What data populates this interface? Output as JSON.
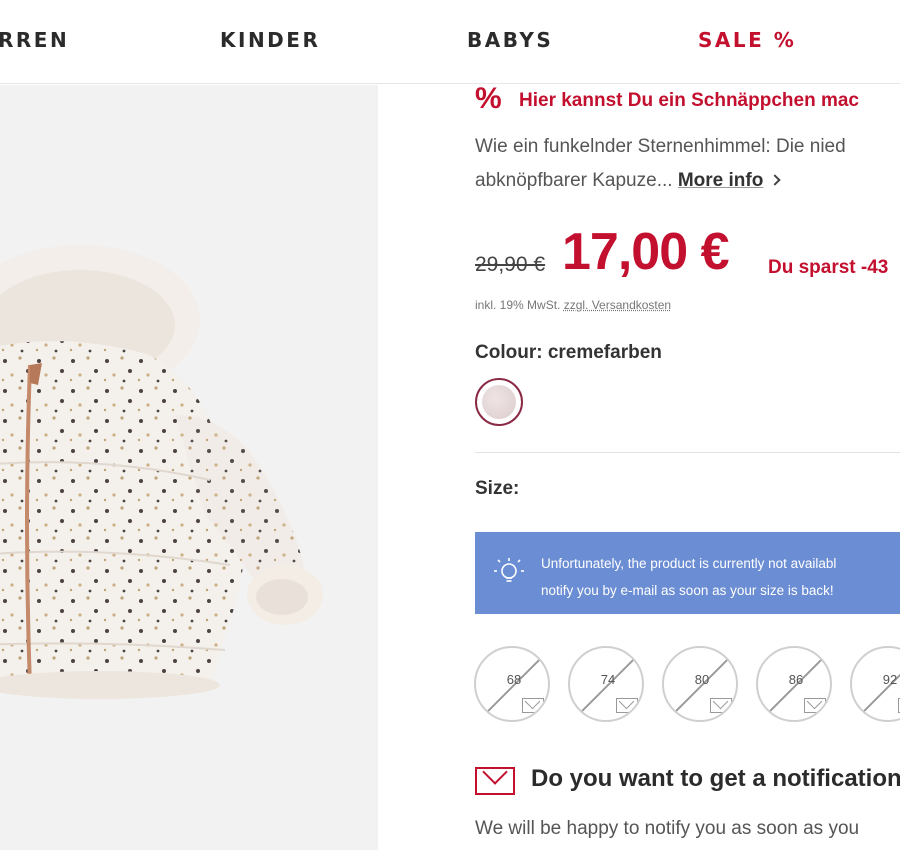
{
  "nav": {
    "items": [
      {
        "label": "RREN"
      },
      {
        "label": "KINDER"
      },
      {
        "label": "BABYS"
      },
      {
        "label": "SALE %"
      }
    ]
  },
  "deal": {
    "icon_text": "%",
    "text": "Hier kannst Du ein Schnäppchen mac"
  },
  "description": {
    "line1": "Wie ein funkelnder Sternenhimmel: Die nied",
    "line2": "abknöpfbarer Kapuze...",
    "more_info": "More info"
  },
  "price": {
    "old": "29,90 €",
    "new": "17,00 €",
    "savings": "Du sparst -43"
  },
  "vat": {
    "prefix": "inkl. 19% MwSt.",
    "link": "zzgl. Versandkosten"
  },
  "colour": {
    "label": "Colour: cremefarben",
    "swatch_color": "#e8dcdc"
  },
  "size": {
    "label": "Size:",
    "notice_line1": "Unfortunately, the product is currently not availabl",
    "notice_line2": "notify you by e-mail as soon as your size is back!",
    "options": [
      "68",
      "74",
      "80",
      "86",
      "92"
    ]
  },
  "notification": {
    "title": "Do you want to get a notification",
    "text": "We will be happy to notify you as soon as you"
  },
  "colors": {
    "accent": "#c3102f",
    "notice_bg": "#6b8dd3"
  }
}
